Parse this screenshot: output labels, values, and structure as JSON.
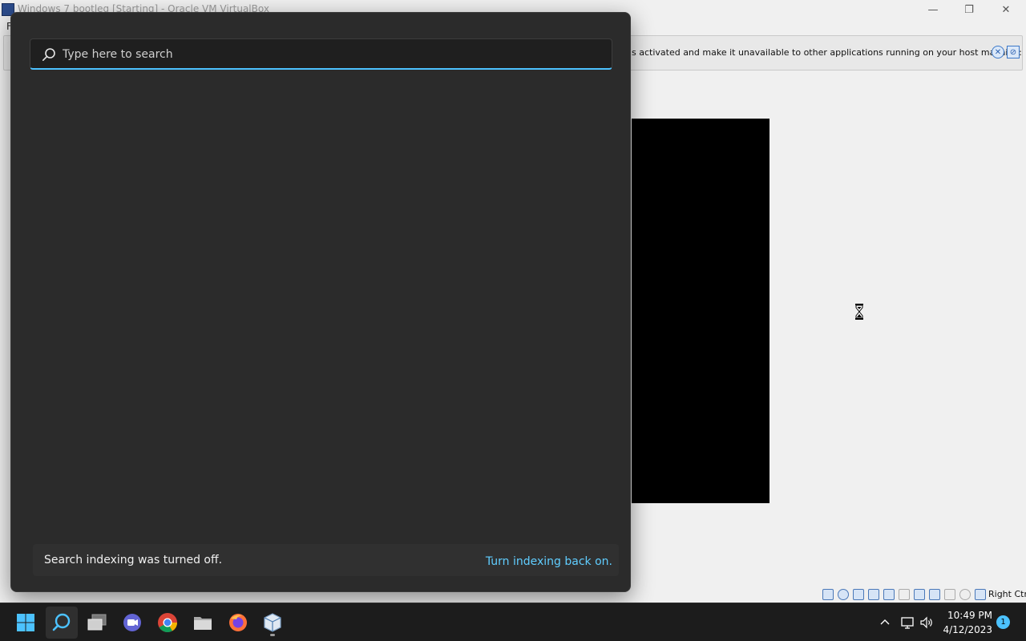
{
  "vbox": {
    "title": "Windows 7 bootleg [Starting] - Oracle VM VirtualBox",
    "menu_first_letter": "F",
    "notice_text": "s activated and make it unavailable to other applications running on your host machine:",
    "host_key_label": "Right Ctrl"
  },
  "search": {
    "placeholder": "Type here to search",
    "value": "",
    "indexing_message": "Search indexing was turned off.",
    "indexing_link": "Turn indexing back on."
  },
  "taskbar": {
    "apps": [
      {
        "name": "start-icon"
      },
      {
        "name": "search-icon",
        "active": true
      },
      {
        "name": "task-view-icon"
      },
      {
        "name": "teams-chat-icon"
      },
      {
        "name": "chrome-icon"
      },
      {
        "name": "file-explorer-icon"
      },
      {
        "name": "firefox-icon"
      },
      {
        "name": "virtualbox-icon",
        "running": true
      }
    ],
    "time": "10:49 PM",
    "date": "4/12/2023",
    "notification_count": "1"
  },
  "colors": {
    "accent": "#4cc2ff",
    "link": "#60cdff",
    "panel": "#2b2b2b",
    "taskbar": "#1c1c1c"
  }
}
